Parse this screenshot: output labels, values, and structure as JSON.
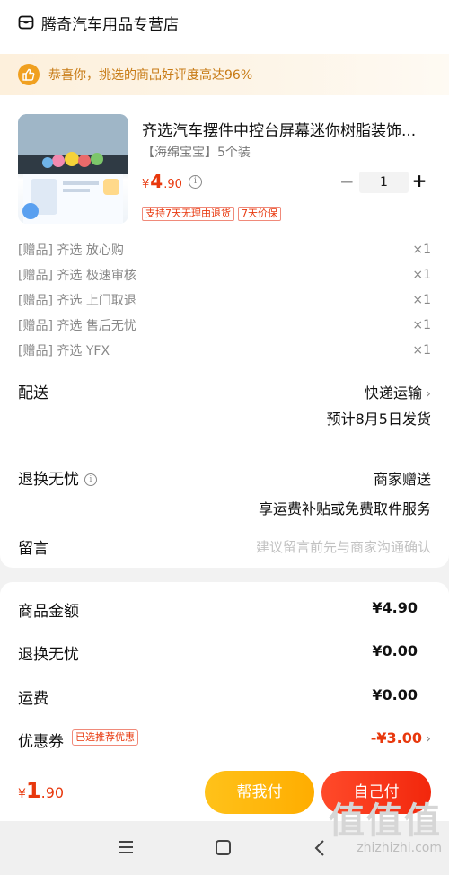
{
  "store": {
    "name": "腾奇汽车用品专营店",
    "icon": "store-icon"
  },
  "banner": {
    "text": "恭喜你，挑选的商品好评度高达96%",
    "icon": "thumbs-up-icon",
    "accent": "#f0a020"
  },
  "product": {
    "title": "齐选汽车摆件中控台屏幕迷你树脂装饰...",
    "spec": "【海绵宝宝】5个装",
    "price": {
      "currency": "¥",
      "int": "4",
      "dec": ".90"
    },
    "quantity": "1",
    "minus": "−",
    "plus": "+",
    "tags": [
      "支持7天无理由退货",
      "7天价保"
    ]
  },
  "gifts": [
    {
      "prefix": "[赠品]",
      "name": "齐选 放心购",
      "qty": "×1"
    },
    {
      "prefix": "[赠品]",
      "name": "齐选 极速审核",
      "qty": "×1"
    },
    {
      "prefix": "[赠品]",
      "name": "齐选 上门取退",
      "qty": "×1"
    },
    {
      "prefix": "[赠品]",
      "name": "齐选 售后无忧",
      "qty": "×1"
    },
    {
      "prefix": "[赠品]",
      "name": "齐选 YFX",
      "qty": "×1"
    }
  ],
  "delivery": {
    "label": "配送",
    "method": "快递运输",
    "estimate": "预计8月5日发货"
  },
  "returns": {
    "label": "退换无忧",
    "value": "商家赠送",
    "desc": "享运费补贴或免费取件服务"
  },
  "message": {
    "label": "留言",
    "placeholder": "建议留言前先与商家沟通确认"
  },
  "summary": {
    "goods_label": "商品金额",
    "goods_value": "¥4.90",
    "returns_label": "退换无忧",
    "returns_value": "¥0.00",
    "shipping_label": "运费",
    "shipping_value": "¥0.00",
    "coupon_label": "优惠券",
    "coupon_badge": "已选推荐优惠",
    "coupon_value": "-¥3.00"
  },
  "footer": {
    "total": {
      "currency": "¥",
      "int": "1",
      "dec": ".90"
    },
    "help_pay": "帮我付",
    "self_pay": "自己付"
  },
  "watermark": {
    "big": "值值值",
    "small": "zhizhizhi.com"
  },
  "colors": {
    "price_red": "#e8380d",
    "help_btn": "#ffb700",
    "self_btn": "#f2270c"
  }
}
